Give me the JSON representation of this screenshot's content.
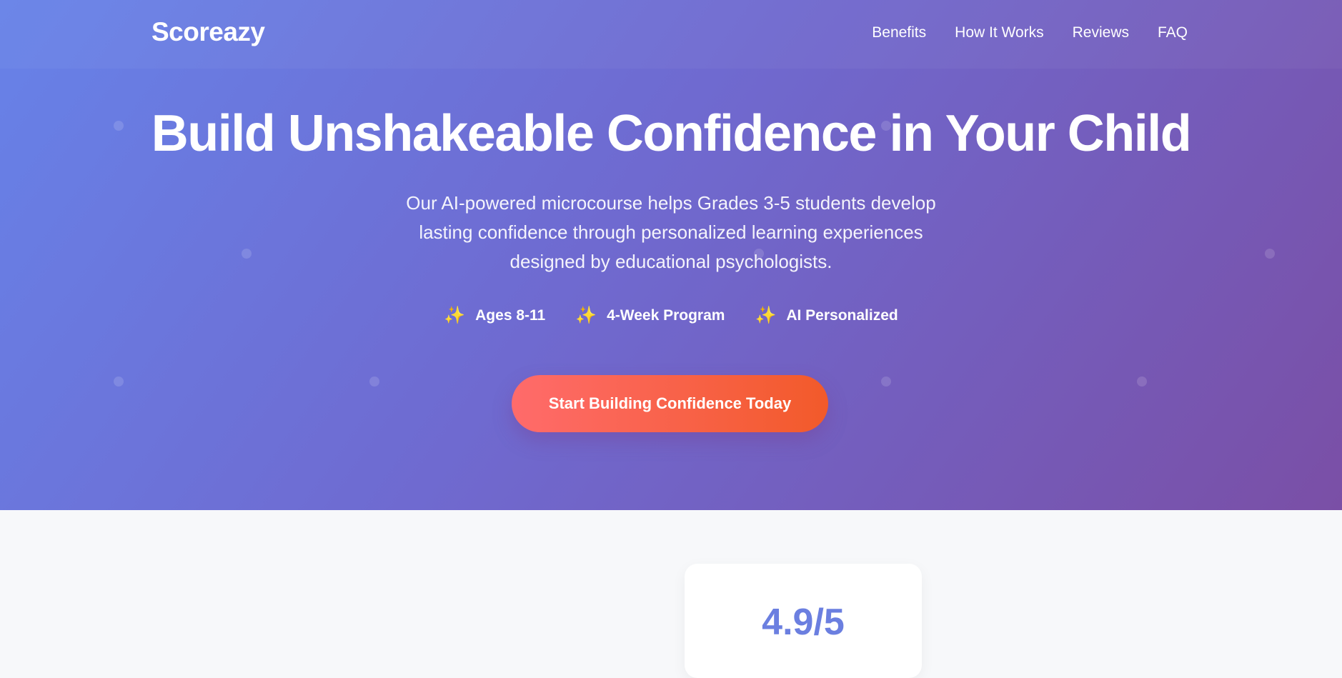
{
  "brand": {
    "name": "Scoreazy"
  },
  "nav": {
    "items": [
      {
        "label": "Benefits"
      },
      {
        "label": "How It Works"
      },
      {
        "label": "Reviews"
      },
      {
        "label": "FAQ"
      }
    ]
  },
  "hero": {
    "title": "Build Unshakeable Confidence in Your Child",
    "subtitle": "Our AI-powered microcourse helps Grades 3-5 students develop lasting confidence through personalized learning experiences designed by educational psychologists.",
    "features": [
      {
        "icon": "sparkles-icon",
        "glyph": "✨",
        "label": "Ages 8-11"
      },
      {
        "icon": "sparkles-icon",
        "glyph": "✨",
        "label": "4-Week Program"
      },
      {
        "icon": "sparkles-icon",
        "glyph": "✨",
        "label": "AI Personalized"
      }
    ],
    "cta_label": "Start Building Confidence Today"
  },
  "stats": {
    "rating_value": "4.9/5"
  },
  "colors": {
    "hero_gradient_start": "#6782e8",
    "hero_gradient_end": "#7a4fa6",
    "cta_start": "#ff6b6b",
    "cta_end": "#f25a2a",
    "accent": "#6b7fe0",
    "page_background": "#f7f8fa"
  }
}
